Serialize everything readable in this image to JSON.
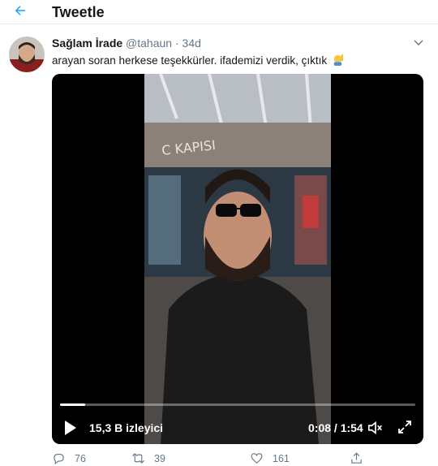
{
  "header": {
    "title": "Tweetle"
  },
  "tweet": {
    "display_name": "Sağlam İrade",
    "handle": "@tahaun",
    "separator": "·",
    "time": "34d",
    "text": "arayan soran herkese teşekkürler. ifademizi verdik, çıktık"
  },
  "video": {
    "sign_text": "C KAPISI",
    "views": "15,3 B izleyici",
    "time": "0:08 / 1:54",
    "progress": 0.07
  },
  "actions": {
    "reply_count": "76",
    "retweet_count": "39",
    "like_count": "161"
  },
  "colors": {
    "accent": "#1da1f2",
    "secondary_text": "#657786",
    "border": "#e6ecf0"
  },
  "icons": {
    "back": "arrow-left-icon",
    "menu": "chevron-down-icon",
    "play": "play-icon",
    "volume": "volume-icon",
    "fullscreen": "fullscreen-icon",
    "reply": "reply-icon",
    "retweet": "retweet-icon",
    "like": "heart-icon",
    "share": "share-icon"
  }
}
